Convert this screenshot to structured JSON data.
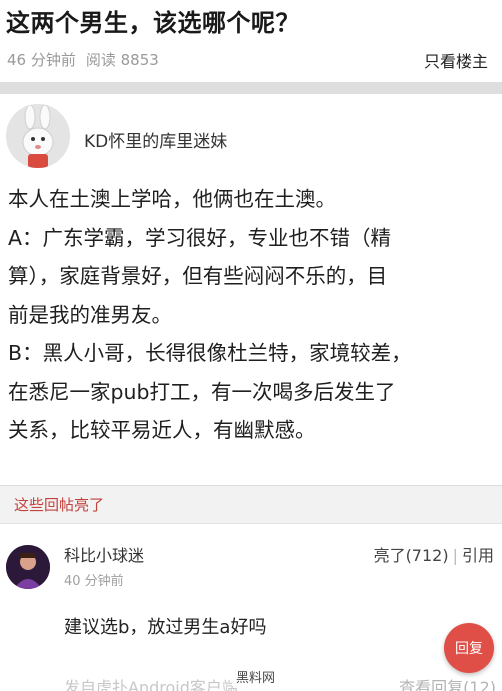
{
  "post": {
    "title": "这两个男生，该选哪个呢？",
    "time_ago": "46 分钟前",
    "reads": "阅读 8853",
    "only_op_label": "只看楼主"
  },
  "op": {
    "username": "KD怀里的库里迷妹",
    "body": [
      "本人在土澳上学哈，他俩也在土澳。",
      "A：广东学霸，学习很好，专业也不错（精",
      "算），家庭背景好，但有些闷闷不乐的，目",
      "前是我的准男友。",
      "B：黑人小哥，长得很像杜兰特，家境较差，",
      "在悉尼一家pub打工，有一次喝多后发生了",
      "关系，比较平易近人，有幽默感。"
    ]
  },
  "highlights": {
    "section_label": "这些回帖亮了",
    "reply": {
      "username": "科比小球迷",
      "time_ago": "40 分钟前",
      "likes_label": "亮了(712)",
      "quote_label": "引用",
      "text": "建议选b，放过男生a好吗",
      "source": "发自虎扑Android客户端",
      "view_replies": "查看回复(12)",
      "reply_button": "回复"
    }
  },
  "watermark": "黑料网",
  "colors": {
    "accent": "#c4423d",
    "reply_button": "#e04f47",
    "meta_gray": "#9a9a9a"
  }
}
